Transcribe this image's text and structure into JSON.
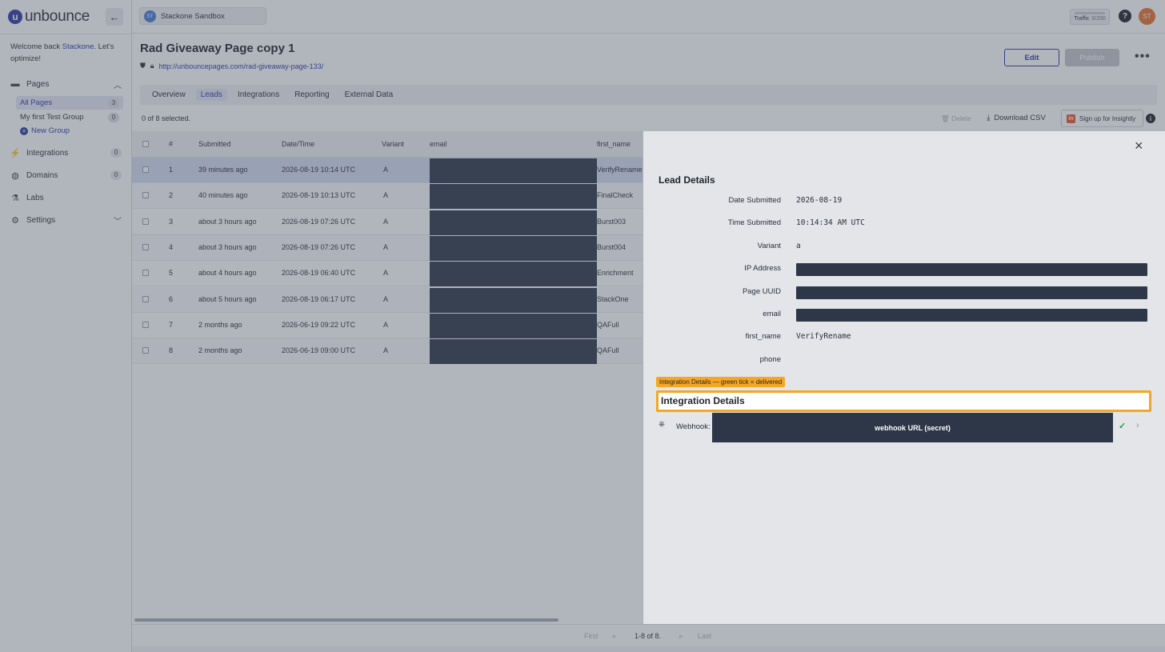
{
  "brand": {
    "name": "unbounce",
    "logo_letter": "u"
  },
  "workspace": {
    "initials": "ST",
    "name": "Stackone Sandbox"
  },
  "header_right": {
    "traffic_label": "Traffic",
    "traffic_value": "0/200",
    "help": "?",
    "avatar": "ST"
  },
  "sidebar": {
    "welcome_prefix": "Welcome back ",
    "welcome_user": "Stackone",
    "welcome_suffix": ". Let's optimize!",
    "pages_label": "Pages",
    "page_groups": [
      {
        "label": "All Pages",
        "count": "3"
      },
      {
        "label": "My first Test Group",
        "count": "0"
      }
    ],
    "new_group": "New Group",
    "integrations": {
      "label": "Integrations",
      "count": "0"
    },
    "domains": {
      "label": "Domains",
      "count": "0"
    },
    "labs": "Labs",
    "settings": "Settings"
  },
  "page": {
    "title": "Rad Giveaway Page copy 1",
    "url": "http://unbouncepages.com/rad-giveaway-page-133/",
    "edit": "Edit",
    "publish": "Publish",
    "more": "•••",
    "tabs": [
      "Overview",
      "Leads",
      "Integrations",
      "Reporting",
      "External Data"
    ]
  },
  "toolbar": {
    "selected": "0 of 8 selected.",
    "delete": "Delete",
    "download": "Download CSV",
    "insightly": "Sign up for Insightly",
    "insightly_logo": "in",
    "info": "i"
  },
  "table": {
    "columns": [
      "#",
      "Submitted",
      "Date/Time",
      "Variant",
      "email",
      "first_name"
    ],
    "rows": [
      {
        "num": "1",
        "submitted": "39 minutes ago",
        "datetime": "2026-08-19 10:14 UTC",
        "variant": "A",
        "first_name": "VerifyRename"
      },
      {
        "num": "2",
        "submitted": "40 minutes ago",
        "datetime": "2026-08-19 10:13 UTC",
        "variant": "A",
        "first_name": "FinalCheck"
      },
      {
        "num": "3",
        "submitted": "about 3 hours ago",
        "datetime": "2026-08-19 07:26 UTC",
        "variant": "A",
        "first_name": "Burst003"
      },
      {
        "num": "4",
        "submitted": "about 3 hours ago",
        "datetime": "2026-08-19 07:26 UTC",
        "variant": "A",
        "first_name": "Burst004"
      },
      {
        "num": "5",
        "submitted": "about 4 hours ago",
        "datetime": "2026-08-19 06:40 UTC",
        "variant": "A",
        "first_name": "Enrichment"
      },
      {
        "num": "6",
        "submitted": "about 5 hours ago",
        "datetime": "2026-08-19 06:17 UTC",
        "variant": "A",
        "first_name": "StackOne"
      },
      {
        "num": "7",
        "submitted": "2 months ago",
        "datetime": "2026-06-19 09:22 UTC",
        "variant": "A",
        "first_name": "QAFull"
      },
      {
        "num": "8",
        "submitted": "2 months ago",
        "datetime": "2026-06-19 09:00 UTC",
        "variant": "A",
        "first_name": "QAFull"
      }
    ]
  },
  "pager": {
    "first": "First",
    "prev": "«",
    "range": "1-8 of 8.",
    "next": "»",
    "last": "Last"
  },
  "lead_details": {
    "title": "Lead Details",
    "close": "×",
    "fields": [
      {
        "label": "Date Submitted",
        "value": "2026-08-19"
      },
      {
        "label": "Time Submitted",
        "value": "10:14:34 AM UTC"
      },
      {
        "label": "Variant",
        "value": "a"
      },
      {
        "label": "IP Address",
        "value": ""
      },
      {
        "label": "Page UUID",
        "value": ""
      },
      {
        "label": "email",
        "value": ""
      },
      {
        "label": "first_name",
        "value": "VerifyRename"
      },
      {
        "label": "phone",
        "value": ""
      }
    ],
    "integration_tag": "Integration Details — green tick = delivered",
    "integration_title": "Integration Details",
    "webhook_label": "Webhook: I",
    "webhook_secret": "webhook URL (secret)",
    "tick": "✓",
    "arrow": "›"
  }
}
